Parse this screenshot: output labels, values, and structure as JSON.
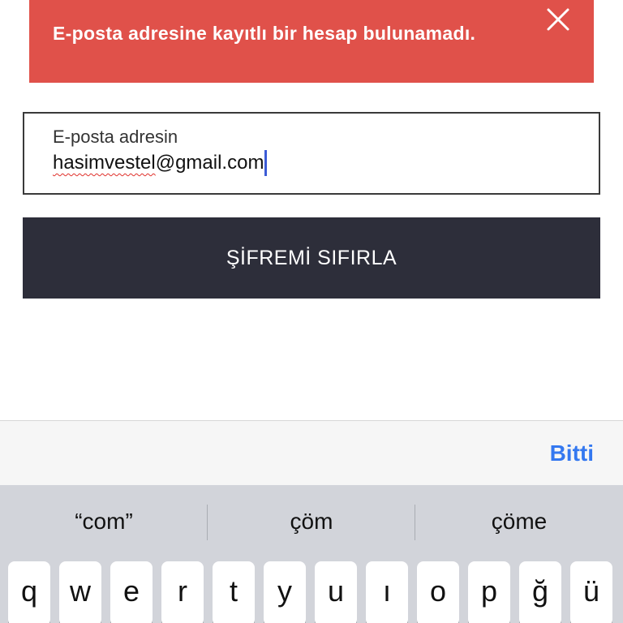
{
  "banner": {
    "message": "E-posta adresine kayıtlı bir hesap bulunamadı.",
    "close_icon": "close-icon",
    "color": "#e0514a"
  },
  "email_field": {
    "label": "E-posta adresin",
    "value_misspelled": "hasimvestel",
    "value_rest": "@gmail.com"
  },
  "reset_button": {
    "label": "ŞİFREMİ SIFIRLA",
    "color": "#2d2e3a"
  },
  "accessory_bar": {
    "done_label": "Bitti",
    "done_color": "#3478f0"
  },
  "keyboard": {
    "suggestions": [
      "“com”",
      "çöm",
      "çöme"
    ],
    "keys": [
      "q",
      "w",
      "e",
      "r",
      "t",
      "y",
      "u",
      "ı",
      "o",
      "p",
      "ğ",
      "ü"
    ]
  }
}
